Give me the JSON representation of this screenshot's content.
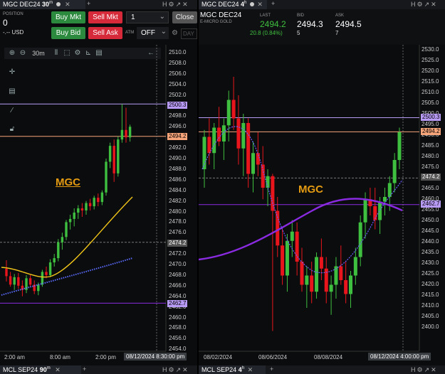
{
  "left": {
    "tab": {
      "symbol": "MGC DEC24",
      "interval": "30",
      "unit": "m"
    },
    "order": {
      "position_label": "POSITION",
      "position_value": "0",
      "pnl": "-.-- USD",
      "buy_mkt": "Buy Mkt",
      "sell_mkt": "Sell Mkt",
      "buy_bid": "Buy Bid",
      "sell_ask": "Sell Ask",
      "qty": "1",
      "close": "Close",
      "atm_label": "ATM",
      "atm_value": "OFF",
      "tif": "DAY"
    },
    "toolbar": {
      "interval": "30m"
    },
    "watermark": "MGC",
    "y_ticks": [
      "2510.0",
      "2508.0",
      "2506.0",
      "2504.0",
      "2502.0",
      "2500.0",
      "2498.0",
      "2496.0",
      "2494.0",
      "2492.0",
      "2490.0",
      "2488.0",
      "2486.0",
      "2484.0",
      "2482.0",
      "2480.0",
      "2478.0",
      "2476.0",
      "2474.0",
      "2472.0",
      "2470.0",
      "2468.0",
      "2466.0",
      "2464.0",
      "2462.0",
      "2460.0",
      "2458.0",
      "2456.0",
      "2454.0"
    ],
    "price_tags": {
      "upper": "2500.3",
      "last": "2494.2",
      "mid": "2474.2",
      "lower": "2462.7"
    },
    "x_ticks": [
      "2:00 am",
      "8:00 am",
      "2:00 pm"
    ],
    "time_badge": "08/12/2024 8:30:00 pm"
  },
  "right": {
    "tab": {
      "symbol": "MGC DEC24",
      "interval": "4",
      "unit": "h"
    },
    "quote": {
      "symbol": "MGC DEC24",
      "desc": "E-MICRO GOLD",
      "last_label": "LAST",
      "last": "2494.2",
      "change": "20.8 (0.84%)",
      "bid_label": "BID",
      "bid": "2494.3",
      "bid_size": "5",
      "ask_label": "ASK",
      "ask": "2494.5",
      "ask_size": "7"
    },
    "watermark": "MGC",
    "y_ticks": [
      "2530.0",
      "2525.0",
      "2520.0",
      "2515.0",
      "2510.0",
      "2505.0",
      "2500.0",
      "2495.0",
      "2490.0",
      "2485.0",
      "2480.0",
      "2475.0",
      "2470.0",
      "2465.0",
      "2460.0",
      "2455.0",
      "2450.0",
      "2445.0",
      "2440.0",
      "2435.0",
      "2430.0",
      "2425.0",
      "2420.0",
      "2415.0",
      "2410.0",
      "2405.0",
      "2400.0"
    ],
    "price_tags": {
      "upper": "2500.3",
      "last": "2494.2",
      "mid": "2474.2",
      "lower": "2462.7"
    },
    "x_ticks": [
      "08/02/2024",
      "08/06/2024",
      "08/08/2024"
    ],
    "time_badge": "08/12/2024 4:00:00 pm"
  },
  "bottom_tabs": {
    "left": {
      "symbol": "MCL SEP24",
      "interval": "90",
      "unit": "m"
    },
    "right": {
      "symbol": "MCL SEP24",
      "interval": "4",
      "unit": "h"
    }
  },
  "colors": {
    "up": "#3fbf3f",
    "down": "#e8161c",
    "tag_orange": "#f6a47a",
    "tag_purple": "#b89bf5",
    "tag_gray": "#555",
    "ma_yellow": "#f0c419",
    "ma_purple": "#8a2be2",
    "dotted_blue": "#5b6cff"
  },
  "chart_data": [
    {
      "type": "candlestick",
      "title": "MGC DEC24 30m",
      "ylim": [
        2454,
        2510
      ],
      "x_labels": [
        "2:00 am",
        "8:00 am",
        "2:00 pm"
      ],
      "series": [
        {
          "name": "",
          "ohlc": [
            [
              2469.2,
              2470.8,
              2466.8,
              2467.8
            ],
            [
              2467.8,
              2468.6,
              2465.8,
              2466.2
            ],
            [
              2466.2,
              2468.2,
              2465.2,
              2467.6
            ],
            [
              2467.6,
              2468.4,
              2465.4,
              2466.0
            ],
            [
              2466.0,
              2467.0,
              2464.0,
              2465.2
            ],
            [
              2465.2,
              2468.0,
              2464.6,
              2467.4
            ],
            [
              2467.4,
              2468.0,
              2465.8,
              2466.2
            ],
            [
              2466.2,
              2467.0,
              2464.4,
              2465.0
            ],
            [
              2465.0,
              2466.6,
              2464.2,
              2466.2
            ],
            [
              2466.2,
              2469.0,
              2465.8,
              2468.6
            ],
            [
              2468.6,
              2469.6,
              2467.4,
              2468.0
            ],
            [
              2468.0,
              2471.0,
              2467.6,
              2470.4
            ],
            [
              2470.4,
              2472.0,
              2469.6,
              2471.2
            ],
            [
              2471.2,
              2474.8,
              2470.6,
              2474.2
            ],
            [
              2474.2,
              2476.0,
              2472.8,
              2475.2
            ],
            [
              2475.2,
              2478.4,
              2474.6,
              2478.0
            ],
            [
              2478.0,
              2479.4,
              2476.6,
              2478.6
            ],
            [
              2478.6,
              2480.6,
              2477.2,
              2479.8
            ],
            [
              2479.8,
              2481.2,
              2478.6,
              2480.6
            ],
            [
              2480.6,
              2481.6,
              2479.0,
              2480.2
            ],
            [
              2480.2,
              2482.0,
              2479.4,
              2481.6
            ],
            [
              2481.6,
              2482.4,
              2480.2,
              2481.0
            ],
            [
              2481.0,
              2483.0,
              2480.4,
              2482.6
            ],
            [
              2482.6,
              2483.4,
              2481.0,
              2481.8
            ],
            [
              2481.8,
              2484.0,
              2481.2,
              2483.6
            ],
            [
              2483.6,
              2490.0,
              2483.0,
              2489.4
            ],
            [
              2489.4,
              2493.0,
              2488.2,
              2492.4
            ],
            [
              2492.4,
              2493.6,
              2485.6,
              2487.2
            ],
            [
              2487.2,
              2494.2,
              2486.6,
              2493.6
            ],
            [
              2493.6,
              2500.3,
              2493.0,
              2495.4
            ],
            [
              2495.4,
              2499.6,
              2493.0,
              2494.0
            ],
            [
              2494.0,
              2496.4,
              2493.2,
              2496.0
            ]
          ]
        }
      ]
    },
    {
      "type": "candlestick",
      "title": "MGC DEC24 4h",
      "ylim": [
        2400,
        2530
      ],
      "x_labels": [
        "08/02/2024",
        "08/06/2024",
        "08/08/2024"
      ],
      "series": [
        {
          "name": "",
          "ohlc": [
            [
              2478,
              2495,
              2470,
              2492
            ],
            [
              2492,
              2500,
              2480,
              2485
            ],
            [
              2485,
              2498,
              2478,
              2496
            ],
            [
              2496,
              2505,
              2488,
              2490
            ],
            [
              2490,
              2500,
              2482,
              2497
            ],
            [
              2497,
              2512,
              2490,
              2508
            ],
            [
              2508,
              2518,
              2495,
              2500
            ],
            [
              2500,
              2510,
              2480,
              2487
            ],
            [
              2487,
              2502,
              2475,
              2498
            ],
            [
              2498,
              2500,
              2470,
              2476
            ],
            [
              2476,
              2490,
              2468,
              2485
            ],
            [
              2485,
              2494,
              2475,
              2480
            ],
            [
              2480,
              2488,
              2465,
              2470
            ],
            [
              2470,
              2478,
              2462,
              2475
            ],
            [
              2475,
              2476,
              2408,
              2460
            ],
            [
              2460,
              2466,
              2440,
              2445
            ],
            [
              2445,
              2452,
              2428,
              2432
            ],
            [
              2432,
              2450,
              2425,
              2447
            ],
            [
              2447,
              2456,
              2440,
              2451
            ],
            [
              2451,
              2455,
              2432,
              2438
            ],
            [
              2438,
              2444,
              2425,
              2428
            ],
            [
              2428,
              2436,
              2418,
              2432
            ],
            [
              2432,
              2438,
              2420,
              2425
            ],
            [
              2425,
              2442,
              2422,
              2440
            ],
            [
              2440,
              2448,
              2430,
              2435
            ],
            [
              2435,
              2440,
              2420,
              2425
            ],
            [
              2425,
              2432,
              2415,
              2428
            ],
            [
              2428,
              2440,
              2422,
              2436
            ],
            [
              2436,
              2445,
              2428,
              2430
            ],
            [
              2430,
              2438,
              2420,
              2424
            ],
            [
              2424,
              2434,
              2418,
              2432
            ],
            [
              2432,
              2444,
              2428,
              2440
            ],
            [
              2440,
              2458,
              2436,
              2455
            ],
            [
              2455,
              2468,
              2448,
              2465
            ],
            [
              2465,
              2470,
              2458,
              2462
            ],
            [
              2462,
              2470,
              2452,
              2456
            ],
            [
              2456,
              2466,
              2450,
              2464
            ],
            [
              2464,
              2470,
              2458,
              2466
            ],
            [
              2466,
              2475,
              2460,
              2472
            ],
            [
              2472,
              2485,
              2468,
              2482
            ],
            [
              2482,
              2496,
              2478,
              2494
            ]
          ]
        }
      ]
    }
  ]
}
